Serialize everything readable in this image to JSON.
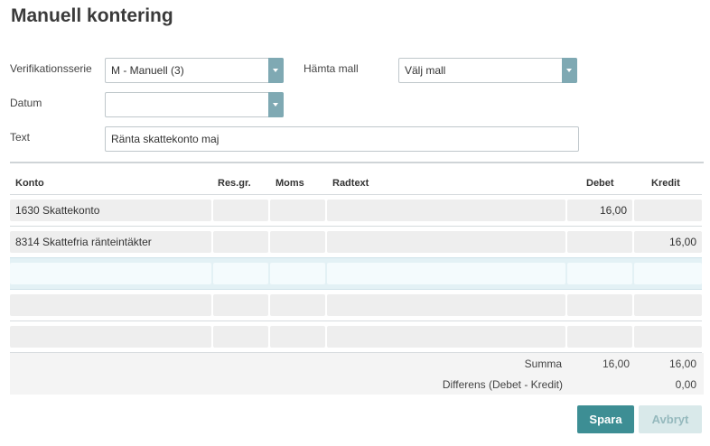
{
  "page": {
    "title": "Manuell kontering"
  },
  "form": {
    "series_label": "Verifikationsserie",
    "series_value": "M - Manuell (3)",
    "template_label": "Hämta mall",
    "template_value": "Välj mall",
    "date_label": "Datum",
    "date_value": "",
    "text_label": "Text",
    "text_value": "Ränta skattekonto maj"
  },
  "table": {
    "columns": {
      "konto": "Konto",
      "resgr": "Res.gr.",
      "moms": "Moms",
      "radtext": "Radtext",
      "debet": "Debet",
      "kredit": "Kredit"
    },
    "rows": [
      {
        "konto": "1630 Skattekonto",
        "resgr": "",
        "moms": "",
        "radtext": "",
        "debet": "16,00",
        "kredit": ""
      },
      {
        "konto": "8314 Skattefria ränteintäkter",
        "resgr": "",
        "moms": "",
        "radtext": "",
        "debet": "",
        "kredit": "16,00"
      },
      {
        "konto": "",
        "resgr": "",
        "moms": "",
        "radtext": "",
        "debet": "",
        "kredit": ""
      },
      {
        "konto": "",
        "resgr": "",
        "moms": "",
        "radtext": "",
        "debet": "",
        "kredit": ""
      },
      {
        "konto": "",
        "resgr": "",
        "moms": "",
        "radtext": "",
        "debet": "",
        "kredit": ""
      }
    ]
  },
  "totals": {
    "summa_label": "Summa",
    "summa_debet": "16,00",
    "summa_kredit": "16,00",
    "diff_label": "Differens (Debet - Kredit)",
    "diff_value": "0,00"
  },
  "actions": {
    "save_label": "Spara",
    "cancel_label": "Avbryt"
  },
  "colors": {
    "accent": "#3d8e94",
    "select_arrow": "#7fa9b3",
    "cancel_bg": "#d9e9ea"
  }
}
